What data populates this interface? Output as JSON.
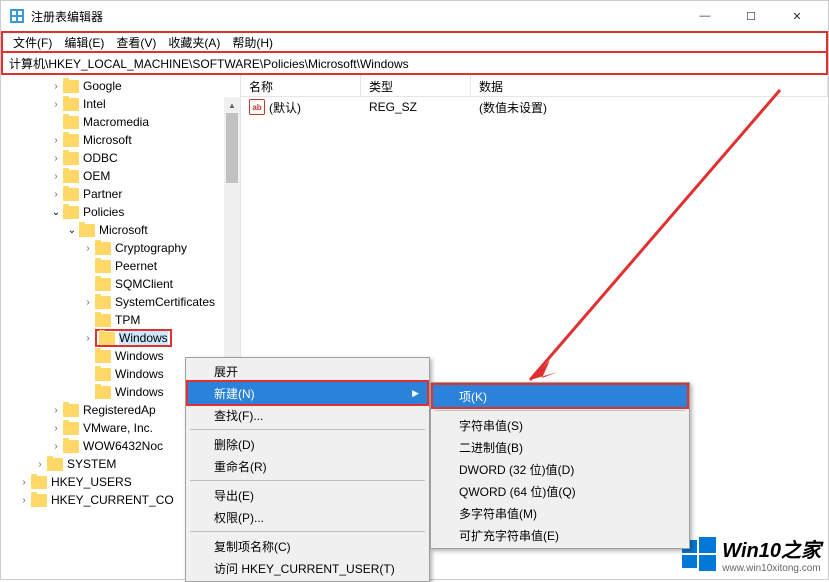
{
  "title": "注册表编辑器",
  "win_controls": {
    "min": "—",
    "max": "☐",
    "close": "✕"
  },
  "menubar": [
    "文件(F)",
    "编辑(E)",
    "查看(V)",
    "收藏夹(A)",
    "帮助(H)"
  ],
  "address": "计算机\\HKEY_LOCAL_MACHINE\\SOFTWARE\\Policies\\Microsoft\\Windows",
  "tree": [
    {
      "depth": 3,
      "arrow": ">",
      "label": "Google"
    },
    {
      "depth": 3,
      "arrow": ">",
      "label": "Intel"
    },
    {
      "depth": 3,
      "arrow": "",
      "label": "Macromedia"
    },
    {
      "depth": 3,
      "arrow": ">",
      "label": "Microsoft"
    },
    {
      "depth": 3,
      "arrow": ">",
      "label": "ODBC"
    },
    {
      "depth": 3,
      "arrow": ">",
      "label": "OEM"
    },
    {
      "depth": 3,
      "arrow": ">",
      "label": "Partner"
    },
    {
      "depth": 3,
      "arrow": "v",
      "label": "Policies"
    },
    {
      "depth": 4,
      "arrow": "v",
      "label": "Microsoft"
    },
    {
      "depth": 5,
      "arrow": ">",
      "label": "Cryptography"
    },
    {
      "depth": 5,
      "arrow": "",
      "label": "Peernet"
    },
    {
      "depth": 5,
      "arrow": "",
      "label": "SQMClient"
    },
    {
      "depth": 5,
      "arrow": ">",
      "label": "SystemCertificates"
    },
    {
      "depth": 5,
      "arrow": "",
      "label": "TPM"
    },
    {
      "depth": 5,
      "arrow": ">",
      "label": "Windows",
      "selected": true
    },
    {
      "depth": 5,
      "arrow": "",
      "label": "Windows"
    },
    {
      "depth": 5,
      "arrow": "",
      "label": "Windows"
    },
    {
      "depth": 5,
      "arrow": "",
      "label": "Windows"
    },
    {
      "depth": 3,
      "arrow": ">",
      "label": "RegisteredAp"
    },
    {
      "depth": 3,
      "arrow": ">",
      "label": "VMware, Inc."
    },
    {
      "depth": 3,
      "arrow": ">",
      "label": "WOW6432Noc"
    },
    {
      "depth": 2,
      "arrow": ">",
      "label": "SYSTEM"
    },
    {
      "depth": 1,
      "arrow": ">",
      "label": "HKEY_USERS"
    },
    {
      "depth": 1,
      "arrow": ">",
      "label": "HKEY_CURRENT_CO"
    }
  ],
  "columns": {
    "name": "名称",
    "type": "类型",
    "data": "数据"
  },
  "rows": [
    {
      "icon": "ab",
      "name": "(默认)",
      "type": "REG_SZ",
      "data": "(数值未设置)"
    }
  ],
  "ctx_main": [
    {
      "label": "展开",
      "type": "item"
    },
    {
      "label": "新建(N)",
      "type": "item",
      "hl": true,
      "arrow": true
    },
    {
      "label": "查找(F)...",
      "type": "item"
    },
    {
      "type": "sep"
    },
    {
      "label": "删除(D)",
      "type": "item"
    },
    {
      "label": "重命名(R)",
      "type": "item"
    },
    {
      "type": "sep"
    },
    {
      "label": "导出(E)",
      "type": "item"
    },
    {
      "label": "权限(P)...",
      "type": "item"
    },
    {
      "type": "sep"
    },
    {
      "label": "复制项名称(C)",
      "type": "item"
    },
    {
      "label": "访问 HKEY_CURRENT_USER(T)",
      "type": "item"
    }
  ],
  "ctx_sub": [
    {
      "label": "项(K)",
      "type": "item",
      "hl": true
    },
    {
      "type": "sep"
    },
    {
      "label": "字符串值(S)",
      "type": "item"
    },
    {
      "label": "二进制值(B)",
      "type": "item"
    },
    {
      "label": "DWORD (32 位)值(D)",
      "type": "item"
    },
    {
      "label": "QWORD (64 位)值(Q)",
      "type": "item"
    },
    {
      "label": "多字符串值(M)",
      "type": "item"
    },
    {
      "label": "可扩充字符串值(E)",
      "type": "item"
    }
  ],
  "watermark": {
    "big": "Win10之家",
    "small": "www.win10xitong.com"
  }
}
